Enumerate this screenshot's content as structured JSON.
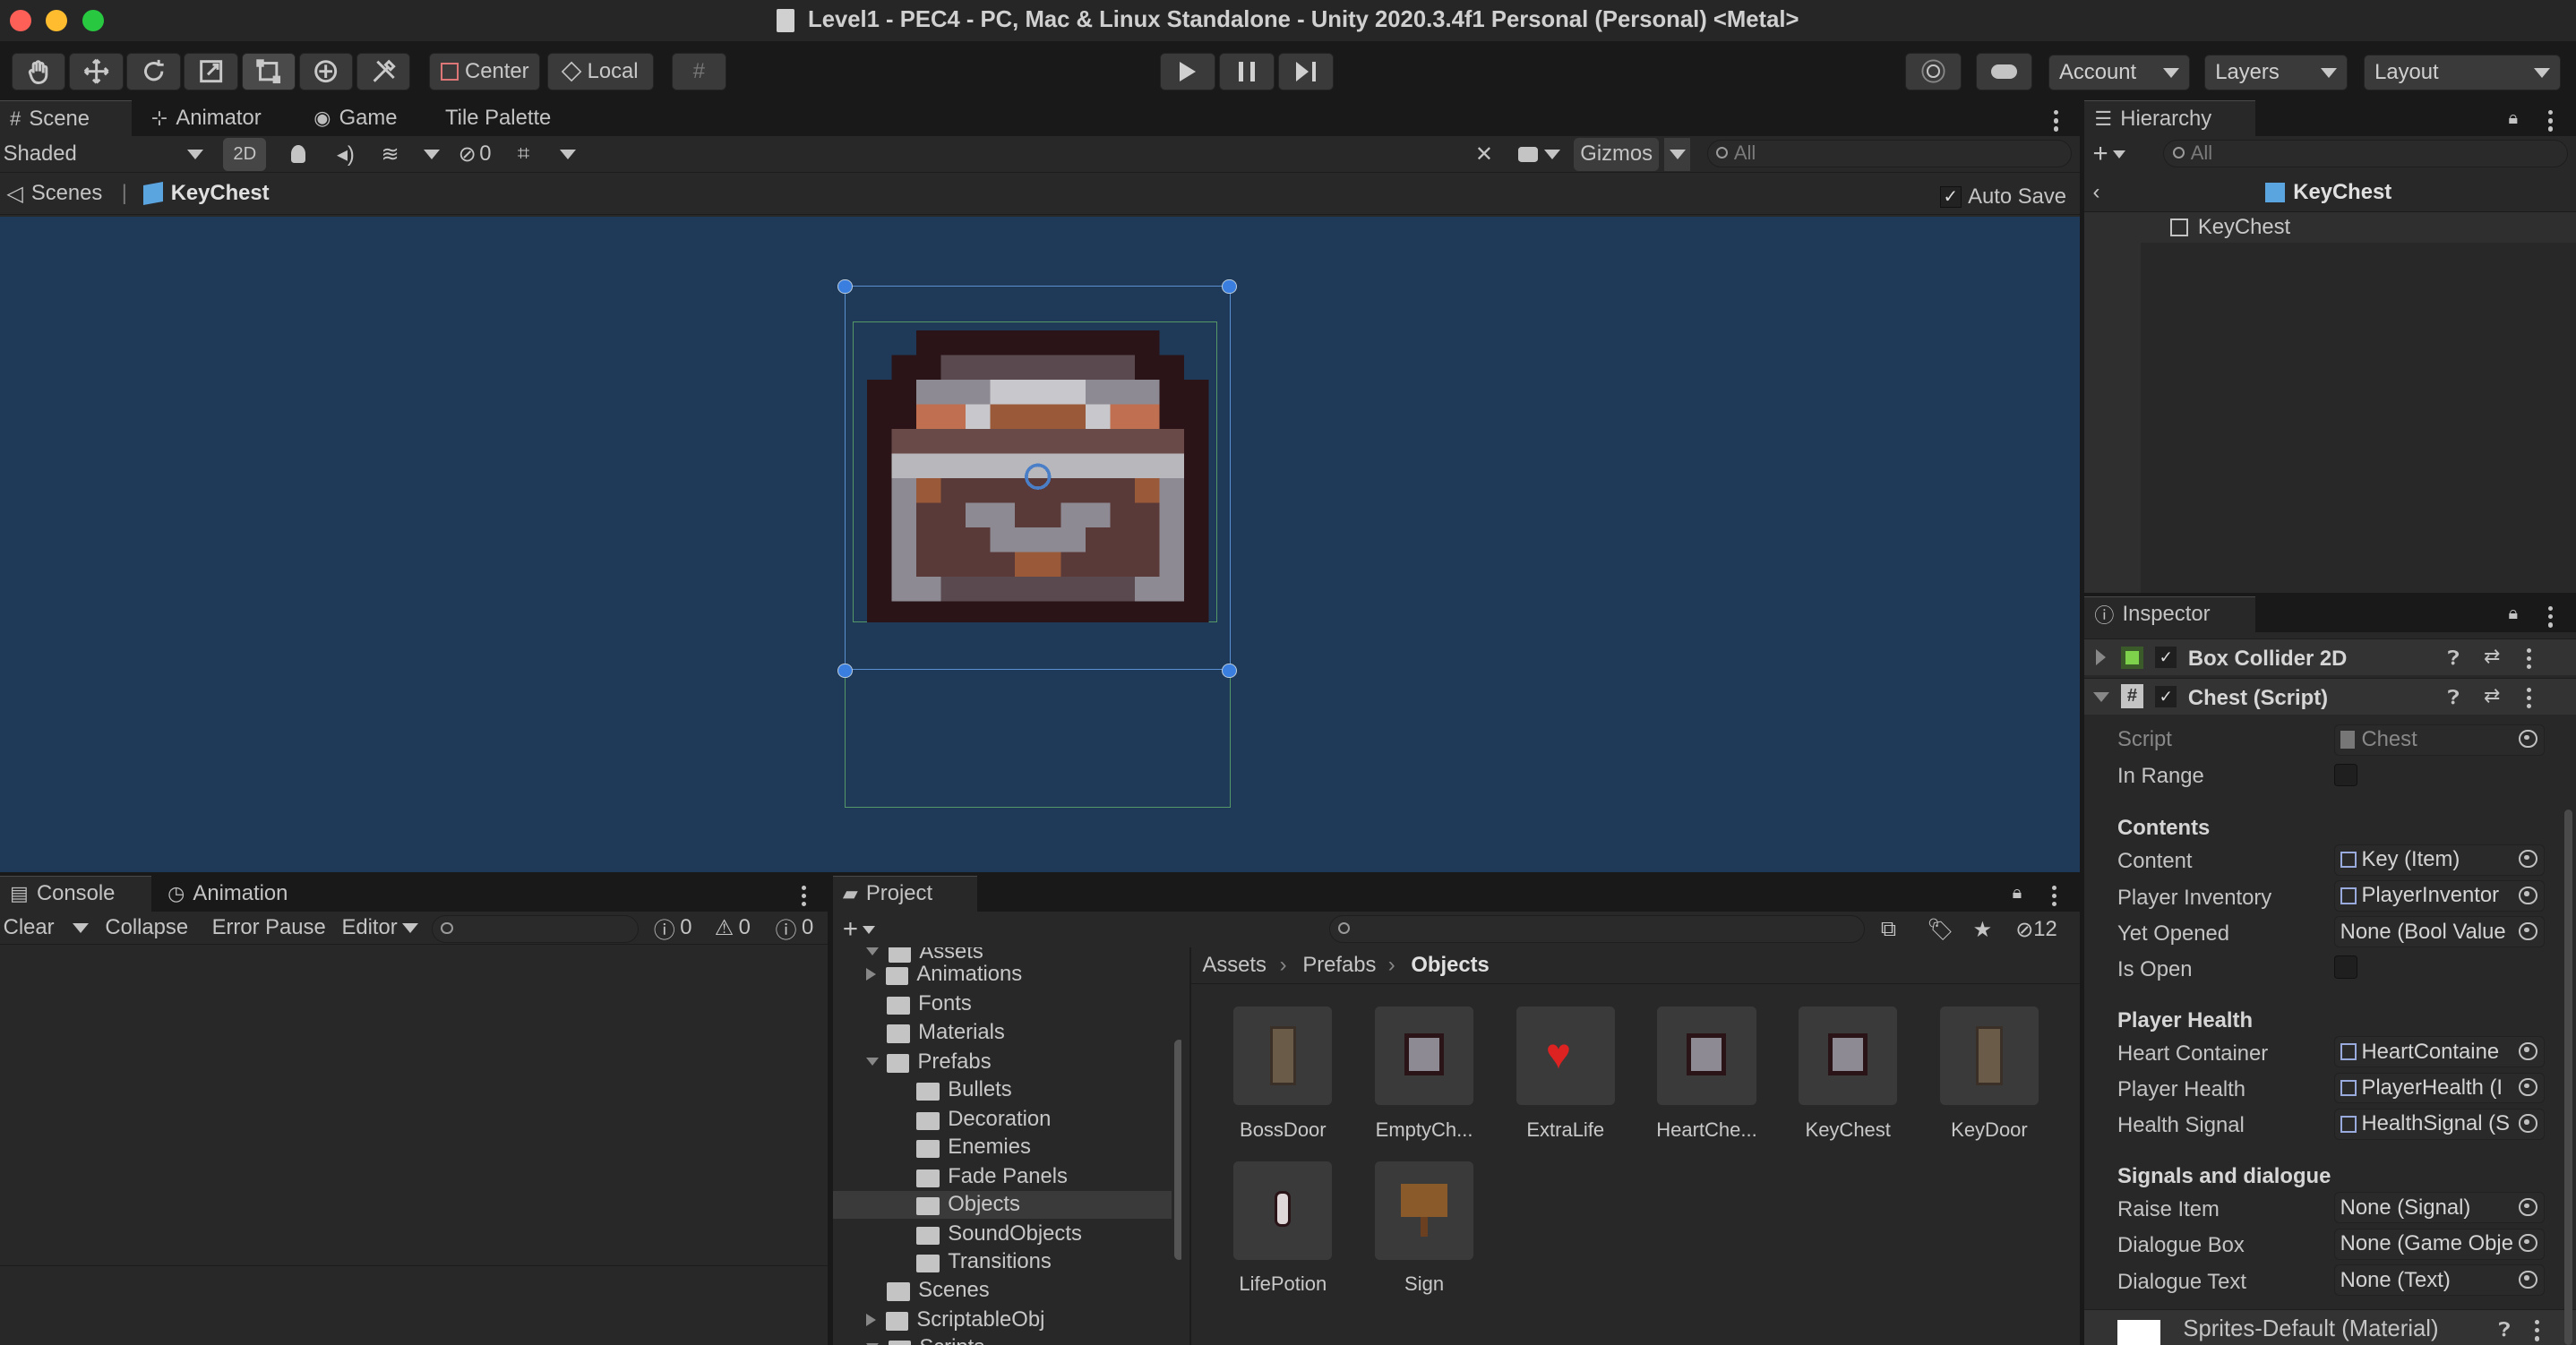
{
  "window": {
    "title": "Level1 - PEC4 - PC, Mac & Linux Standalone - Unity 2020.3.4f1 Personal (Personal) <Metal>"
  },
  "toolbar": {
    "center": "Center",
    "local": "Local",
    "account": "Account",
    "layers": "Layers",
    "layout": "Layout"
  },
  "scene": {
    "tabs": [
      "Scene",
      "Animator",
      "Game",
      "Tile Palette"
    ],
    "shading": "Shaded",
    "mode_2d": "2D",
    "hidden_count": "0",
    "gizmos": "Gizmos",
    "search_placeholder": "All",
    "breadcrumb_root": "Scenes",
    "breadcrumb_prefab": "KeyChest",
    "auto_save": "Auto Save",
    "background": "#1f3a58"
  },
  "hierarchy": {
    "tab": "Hierarchy",
    "search_placeholder": "All",
    "prefab_header": "KeyChest",
    "item": "KeyChest"
  },
  "inspector": {
    "tab": "Inspector",
    "components": [
      {
        "name": "Box Collider 2D"
      },
      {
        "name": "Chest (Script)"
      }
    ],
    "script": {
      "label": "Script",
      "value": "Chest"
    },
    "in_range": {
      "label": "In Range"
    },
    "contents_header": "Contents",
    "contents": [
      {
        "label": "Content",
        "value": "Key (Item)"
      },
      {
        "label": "Player Inventory",
        "value": "PlayerInventor"
      },
      {
        "label": "Yet Opened",
        "value": "None (Bool Value"
      }
    ],
    "is_open": {
      "label": "Is Open"
    },
    "player_health_header": "Player Health",
    "player_health": [
      {
        "label": "Heart Container",
        "value": "HeartContaine"
      },
      {
        "label": "Player Health",
        "value": "PlayerHealth (I"
      },
      {
        "label": "Health Signal",
        "value": "HealthSignal (S"
      }
    ],
    "signals_header": "Signals and dialogue",
    "signals": [
      {
        "label": "Raise Item",
        "value": "None (Signal)"
      },
      {
        "label": "Dialogue Box",
        "value": "None (Game Obje"
      },
      {
        "label": "Dialogue Text",
        "value": "None (Text)"
      }
    ],
    "material": "Sprites-Default (Material)"
  },
  "console": {
    "tabs": [
      "Console",
      "Animation"
    ],
    "clear": "Clear",
    "collapse": "Collapse",
    "error_pause": "Error Pause",
    "editor": "Editor",
    "info_count": "0",
    "warn_count": "0",
    "error_count": "0"
  },
  "project": {
    "tab": "Project",
    "hidden_count": "12",
    "tree": [
      "Assets",
      "Animations",
      "Fonts",
      "Materials",
      "Prefabs",
      "Bullets",
      "Decoration",
      "Enemies",
      "Fade Panels",
      "Objects",
      "SoundObjects",
      "Transitions",
      "Scenes",
      "ScriptableObj",
      "Scripts"
    ],
    "breadcrumb": [
      "Assets",
      "Prefabs",
      "Objects"
    ],
    "assets": [
      "BossDoor",
      "EmptyCh...",
      "ExtraLife",
      "HeartChe...",
      "KeyChest",
      "KeyDoor",
      "LifePotion",
      "Sign"
    ]
  }
}
